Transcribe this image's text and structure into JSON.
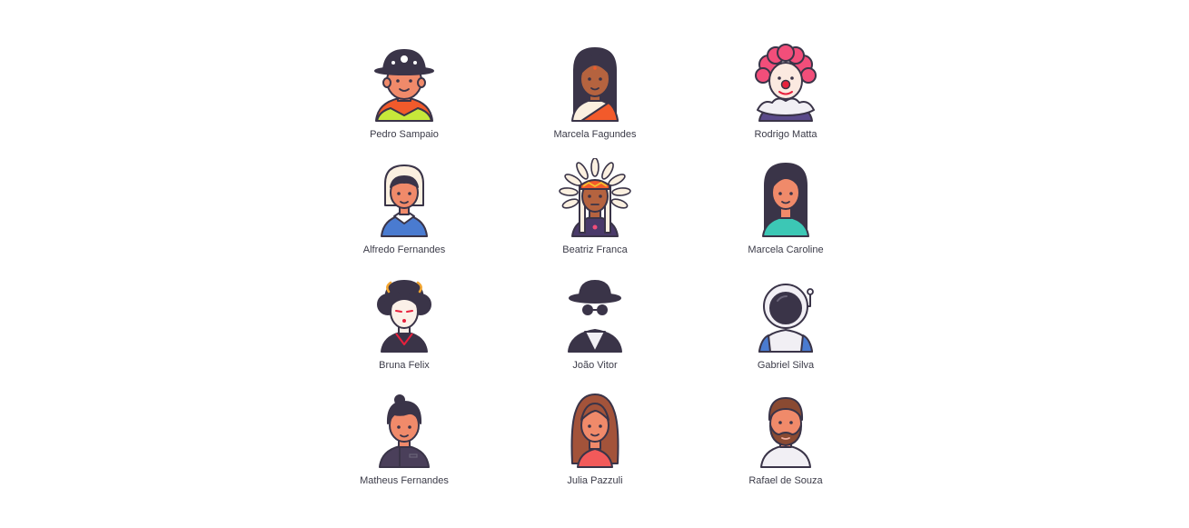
{
  "users": [
    {
      "name": "Pedro Sampaio",
      "icon": "firefighter-avatar-icon"
    },
    {
      "name": "Marcela Fagundes",
      "icon": "indian-woman-avatar-icon"
    },
    {
      "name": "Rodrigo Matta",
      "icon": "clown-avatar-icon"
    },
    {
      "name": "Alfredo Fernandes",
      "icon": "pilgrim-woman-avatar-icon"
    },
    {
      "name": "Beatriz Franca",
      "icon": "native-chief-avatar-icon"
    },
    {
      "name": "Marcela Caroline",
      "icon": "long-hair-woman-avatar-icon"
    },
    {
      "name": "Bruna Felix",
      "icon": "geisha-avatar-icon"
    },
    {
      "name": "João Vitor",
      "icon": "spy-avatar-icon"
    },
    {
      "name": "Gabriel Silva",
      "icon": "astronaut-avatar-icon"
    },
    {
      "name": "Matheus Fernandes",
      "icon": "student-avatar-icon"
    },
    {
      "name": "Julia Pazzuli",
      "icon": "brown-hair-woman-avatar-icon"
    },
    {
      "name": "Rafael de Souza",
      "icon": "bearded-man-avatar-icon"
    }
  ],
  "colors": {
    "outline": "#3a3448",
    "skin": "#f08a6a",
    "skin_dark": "#b5633f",
    "skin_pale": "#fbe9e0",
    "label": "#3b3b48"
  }
}
